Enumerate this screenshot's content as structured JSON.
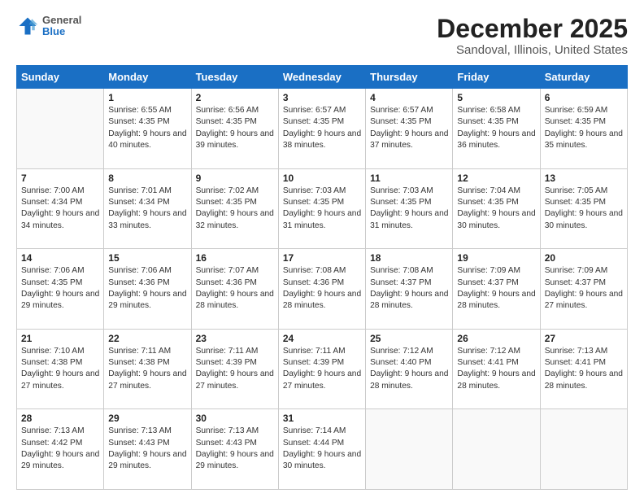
{
  "logo": {
    "general": "General",
    "blue": "Blue"
  },
  "title": "December 2025",
  "subtitle": "Sandoval, Illinois, United States",
  "days": [
    "Sunday",
    "Monday",
    "Tuesday",
    "Wednesday",
    "Thursday",
    "Friday",
    "Saturday"
  ],
  "weeks": [
    [
      {
        "date": "",
        "empty": true
      },
      {
        "date": "1",
        "sunrise": "6:55 AM",
        "sunset": "4:35 PM",
        "daylight": "9 hours and 40 minutes."
      },
      {
        "date": "2",
        "sunrise": "6:56 AM",
        "sunset": "4:35 PM",
        "daylight": "9 hours and 39 minutes."
      },
      {
        "date": "3",
        "sunrise": "6:57 AM",
        "sunset": "4:35 PM",
        "daylight": "9 hours and 38 minutes."
      },
      {
        "date": "4",
        "sunrise": "6:57 AM",
        "sunset": "4:35 PM",
        "daylight": "9 hours and 37 minutes."
      },
      {
        "date": "5",
        "sunrise": "6:58 AM",
        "sunset": "4:35 PM",
        "daylight": "9 hours and 36 minutes."
      },
      {
        "date": "6",
        "sunrise": "6:59 AM",
        "sunset": "4:35 PM",
        "daylight": "9 hours and 35 minutes."
      }
    ],
    [
      {
        "date": "7",
        "sunrise": "7:00 AM",
        "sunset": "4:34 PM",
        "daylight": "9 hours and 34 minutes."
      },
      {
        "date": "8",
        "sunrise": "7:01 AM",
        "sunset": "4:34 PM",
        "daylight": "9 hours and 33 minutes."
      },
      {
        "date": "9",
        "sunrise": "7:02 AM",
        "sunset": "4:35 PM",
        "daylight": "9 hours and 32 minutes."
      },
      {
        "date": "10",
        "sunrise": "7:03 AM",
        "sunset": "4:35 PM",
        "daylight": "9 hours and 31 minutes."
      },
      {
        "date": "11",
        "sunrise": "7:03 AM",
        "sunset": "4:35 PM",
        "daylight": "9 hours and 31 minutes."
      },
      {
        "date": "12",
        "sunrise": "7:04 AM",
        "sunset": "4:35 PM",
        "daylight": "9 hours and 30 minutes."
      },
      {
        "date": "13",
        "sunrise": "7:05 AM",
        "sunset": "4:35 PM",
        "daylight": "9 hours and 30 minutes."
      }
    ],
    [
      {
        "date": "14",
        "sunrise": "7:06 AM",
        "sunset": "4:35 PM",
        "daylight": "9 hours and 29 minutes."
      },
      {
        "date": "15",
        "sunrise": "7:06 AM",
        "sunset": "4:36 PM",
        "daylight": "9 hours and 29 minutes."
      },
      {
        "date": "16",
        "sunrise": "7:07 AM",
        "sunset": "4:36 PM",
        "daylight": "9 hours and 28 minutes."
      },
      {
        "date": "17",
        "sunrise": "7:08 AM",
        "sunset": "4:36 PM",
        "daylight": "9 hours and 28 minutes."
      },
      {
        "date": "18",
        "sunrise": "7:08 AM",
        "sunset": "4:37 PM",
        "daylight": "9 hours and 28 minutes."
      },
      {
        "date": "19",
        "sunrise": "7:09 AM",
        "sunset": "4:37 PM",
        "daylight": "9 hours and 28 minutes."
      },
      {
        "date": "20",
        "sunrise": "7:09 AM",
        "sunset": "4:37 PM",
        "daylight": "9 hours and 27 minutes."
      }
    ],
    [
      {
        "date": "21",
        "sunrise": "7:10 AM",
        "sunset": "4:38 PM",
        "daylight": "9 hours and 27 minutes."
      },
      {
        "date": "22",
        "sunrise": "7:11 AM",
        "sunset": "4:38 PM",
        "daylight": "9 hours and 27 minutes."
      },
      {
        "date": "23",
        "sunrise": "7:11 AM",
        "sunset": "4:39 PM",
        "daylight": "9 hours and 27 minutes."
      },
      {
        "date": "24",
        "sunrise": "7:11 AM",
        "sunset": "4:39 PM",
        "daylight": "9 hours and 27 minutes."
      },
      {
        "date": "25",
        "sunrise": "7:12 AM",
        "sunset": "4:40 PM",
        "daylight": "9 hours and 28 minutes."
      },
      {
        "date": "26",
        "sunrise": "7:12 AM",
        "sunset": "4:41 PM",
        "daylight": "9 hours and 28 minutes."
      },
      {
        "date": "27",
        "sunrise": "7:13 AM",
        "sunset": "4:41 PM",
        "daylight": "9 hours and 28 minutes."
      }
    ],
    [
      {
        "date": "28",
        "sunrise": "7:13 AM",
        "sunset": "4:42 PM",
        "daylight": "9 hours and 29 minutes."
      },
      {
        "date": "29",
        "sunrise": "7:13 AM",
        "sunset": "4:43 PM",
        "daylight": "9 hours and 29 minutes."
      },
      {
        "date": "30",
        "sunrise": "7:13 AM",
        "sunset": "4:43 PM",
        "daylight": "9 hours and 29 minutes."
      },
      {
        "date": "31",
        "sunrise": "7:14 AM",
        "sunset": "4:44 PM",
        "daylight": "9 hours and 30 minutes."
      },
      {
        "date": "",
        "empty": true
      },
      {
        "date": "",
        "empty": true
      },
      {
        "date": "",
        "empty": true
      }
    ]
  ]
}
